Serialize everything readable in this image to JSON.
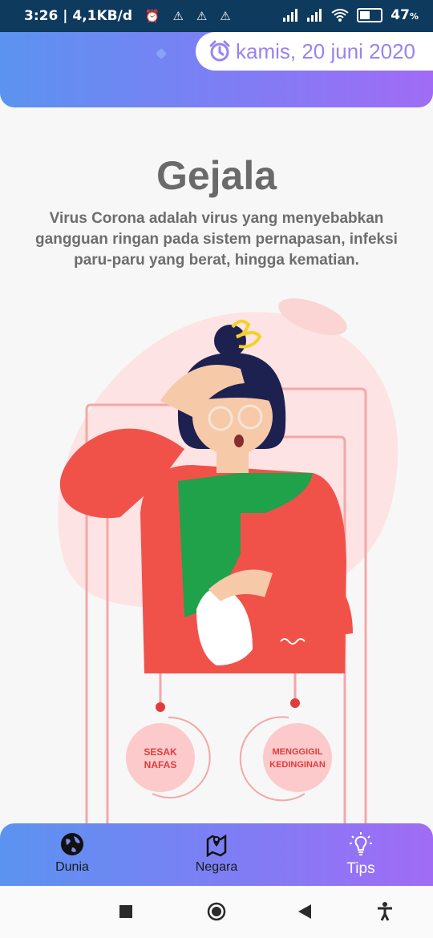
{
  "status_bar": {
    "time": "3:26",
    "net_speed": "4,1KB/d",
    "battery": "47",
    "battery_unit": "%",
    "battery_fraction": 0.47
  },
  "header": {
    "date": "kamis, 20 juni 2020",
    "icon": "alarm-clock-icon"
  },
  "main": {
    "title": "Gejala",
    "description": "Virus Corona adalah virus yang menyebabkan gangguan ringan pada sistem pernapasan, infeksi paru-paru yang berat, hingga kematian.",
    "symptom_1_line1": "SESAK",
    "symptom_1_line2": "NAFAS",
    "symptom_2_line1": "MENGGIGIL",
    "symptom_2_line2": "KEDINGINAN"
  },
  "bottom_nav": {
    "items": [
      {
        "label": "Dunia",
        "icon": "globe-icon"
      },
      {
        "label": "Negara",
        "icon": "map-pin-icon"
      },
      {
        "label": "Tips",
        "icon": "lightbulb-icon"
      }
    ],
    "active": "Tips"
  },
  "colors": {
    "gradient_start": "#5b93f0",
    "gradient_end": "#a06cf6",
    "accent_text": "#9a83ee",
    "illustration_red": "#f0524a",
    "illustration_green": "#1fa24a"
  }
}
